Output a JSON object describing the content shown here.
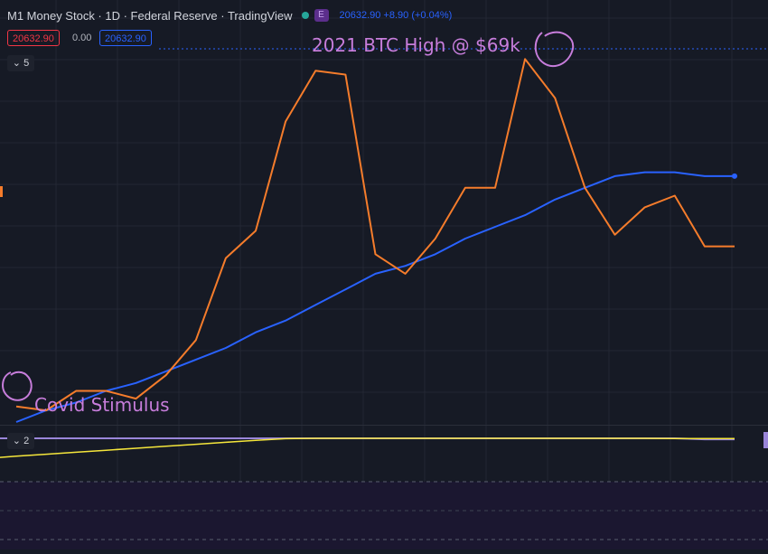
{
  "legend": {
    "title": "M1 Money Stock · 1D · Federal Reserve · TradingView",
    "badge": "E",
    "quote": "20632.90 +8.90 (+0.04%)"
  },
  "chips": {
    "red": "20632.90",
    "plain": "0.00",
    "blue": "20632.90"
  },
  "panes": {
    "main_collapse": "5",
    "lower_collapse": "2"
  },
  "annotations": {
    "top": "2021 BTC High @ $69k",
    "bottom": "Covid Stimulus"
  },
  "colors": {
    "background": "#161a25",
    "m1_line": "#2962ff",
    "btc_line": "#f57c2b",
    "lower_yellow": "#f5e63b",
    "lower_purple": "#9a86d9",
    "annotation": "#c77ddb"
  },
  "chart_data": {
    "type": "line",
    "x": [
      0,
      1,
      2,
      3,
      4,
      5,
      6,
      7,
      8,
      9,
      10,
      11,
      12,
      13,
      14,
      15,
      16,
      17,
      18,
      19,
      20,
      21,
      22,
      23,
      24
    ],
    "ylim": [
      0,
      100
    ],
    "grid": true,
    "series": [
      {
        "values": [
          3,
          6,
          8,
          11,
          13,
          16,
          19,
          22,
          26,
          29,
          33,
          37,
          41,
          43,
          46,
          50,
          53,
          56,
          60,
          63,
          66,
          67,
          67,
          66,
          66
        ]
      },
      {
        "values": [
          7,
          6,
          11,
          11,
          9,
          15,
          24,
          45,
          52,
          80,
          93,
          92,
          46,
          41,
          50,
          63,
          63,
          96,
          86,
          63,
          51,
          58,
          61,
          48,
          48
        ]
      }
    ],
    "lower_pane": {
      "ylim": [
        0,
        100
      ],
      "yellow": [
        10,
        20,
        30,
        40,
        50,
        60,
        70,
        80,
        90,
        98,
        100,
        100,
        100,
        100,
        100,
        100,
        100,
        100,
        100,
        100,
        100,
        100,
        99,
        99,
        99
      ],
      "purple": [
        100,
        100,
        100,
        100,
        100,
        100,
        100,
        100,
        100,
        100,
        100,
        100,
        100,
        100,
        100,
        100,
        100,
        100,
        100,
        100,
        100,
        100,
        100,
        95,
        95
      ]
    }
  }
}
